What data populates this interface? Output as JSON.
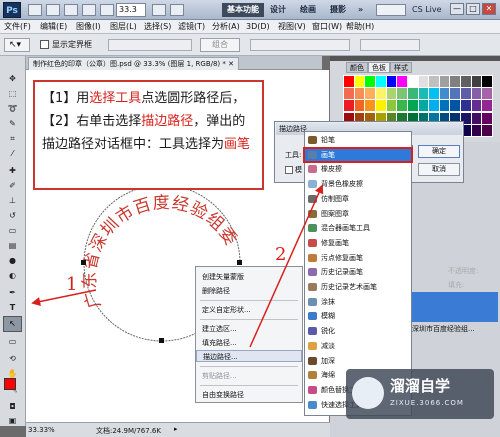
{
  "titlebar": {
    "logo": "Ps",
    "zoom": "33.3",
    "workspaces": [
      "基本功能",
      "设计",
      "绘画",
      "摄影"
    ],
    "more": "»",
    "cslive": "CS Live",
    "controls": [
      "—",
      "□",
      "✕"
    ]
  },
  "menubar": [
    "文件(F)",
    "编辑(E)",
    "图像(I)",
    "图层(L)",
    "选择(S)",
    "滤镜(T)",
    "分析(A)",
    "3D(D)",
    "视图(V)",
    "窗口(W)",
    "帮助(H)"
  ],
  "optionsbar": {
    "show_bounds": "显示定界框",
    "combine": "组合"
  },
  "document_tab": "制作红色的印章（公章）图.psd @ 33.3% (图层 1, RGB/8) *",
  "annotation": {
    "p1": "【1】用",
    "p1_red": "选择工具",
    "p2": "点选圆形路径后，【2】右单击选择",
    "p2_red": "描边路径",
    "p3": "，弹出的描边路径对话框中：工具选择为",
    "p3_red": "画笔"
  },
  "seal_text": "广东省深圳市百度经验组委",
  "arrows": {
    "label1": "1",
    "label2": "2"
  },
  "context_menu": {
    "items": [
      "创建矢量蒙版",
      "删除路径",
      "定义自定形状...",
      "建立选区...",
      "填充路径...",
      "描边路径...",
      "剪贴路径...",
      "自由变换路径"
    ],
    "highlighted": "描边路径..."
  },
  "stroke_dialog": {
    "title": "描边路径",
    "tool_label": "工具:",
    "tool_value": "画笔",
    "simulate_label": "模",
    "ok": "确定",
    "cancel": "取消"
  },
  "tool_dropdown": {
    "items": [
      "铅笔",
      "画笔",
      "橡皮擦",
      "背景色橡皮擦",
      "仿制图章",
      "图案图章",
      "混合器画笔工具",
      "修复画笔",
      "污点修复画笔",
      "历史记录画笔",
      "历史记录艺术画笔",
      "涂抹",
      "模糊",
      "锐化",
      "减淡",
      "加深",
      "海绵",
      "颜色替换工具",
      "快速选择工具"
    ],
    "selected": "画笔"
  },
  "swatch_panel": {
    "tabs": [
      "颜色",
      "色板",
      "样式"
    ]
  },
  "layers_panel": {
    "opacity_label": "不透明度:",
    "fill_label": "填充:",
    "layer_name": "深圳市百度经验组..."
  },
  "statusbar": {
    "zoom": "33.33%",
    "doc": "文档:24.9M/767.6K"
  },
  "watermark": {
    "title": "溜溜自学",
    "url": "ZIXUE.3066.COM"
  },
  "colors": {
    "accent_red": "#d8201c",
    "highlight_blue": "#2f7ad8",
    "seal_red": "#c9372e"
  }
}
